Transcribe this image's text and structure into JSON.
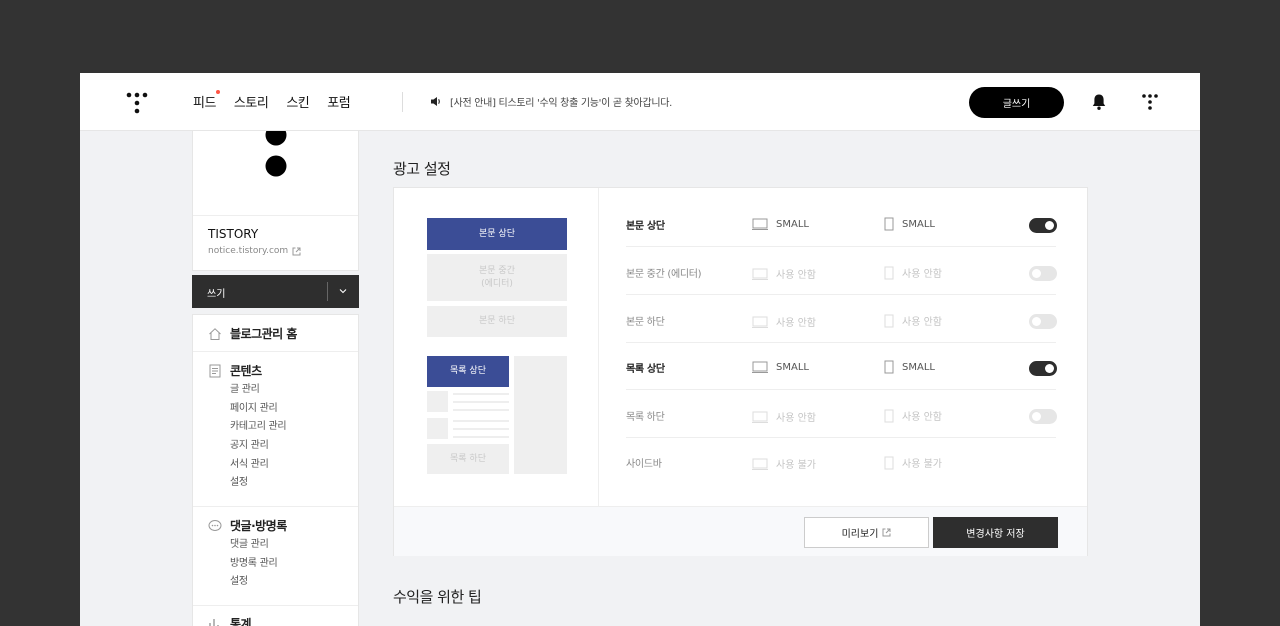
{
  "header": {
    "nav": [
      "피드",
      "스토리",
      "스킨",
      "포럼"
    ],
    "notice": "[사전 안내] 티스토리 '수익 창출 기능'이 곧 찾아갑니다.",
    "write_button": "글쓰기",
    "accent_color": "#ff5544"
  },
  "sidebar": {
    "blog_name": "TISTORY",
    "blog_url": "notice.tistory.com",
    "write_label": "쓰기",
    "home_label": "블로그관리 홈",
    "groups": [
      {
        "title": "콘텐츠",
        "icon": "document-icon",
        "items": [
          "글 관리",
          "페이지 관리",
          "카테고리 관리",
          "공지 관리",
          "서식 관리",
          "설정"
        ]
      },
      {
        "title": "댓글·방명록",
        "icon": "comment-icon",
        "items": [
          "댓글 관리",
          "방명록 관리",
          "설정"
        ]
      },
      {
        "title": "통계",
        "icon": "chart-icon",
        "items": []
      }
    ]
  },
  "main": {
    "ad_title": "광고 설정",
    "tips_title": "수익을 위한 팁",
    "preview": {
      "body_top": "본문 상단",
      "body_middle_line1": "본문 중간",
      "body_middle_line2": "(에디터)",
      "body_bottom": "본문 하단",
      "list_top": "목록 상단",
      "list_bottom": "목록 하단",
      "active_color": "#3b4d96"
    },
    "rows": [
      {
        "name": "본문 상단",
        "pc": "SMALL",
        "mobile": "SMALL",
        "toggle": "on"
      },
      {
        "name": "본문 중간 (에디터)",
        "pc": "사용 안함",
        "mobile": "사용 안함",
        "toggle": "off"
      },
      {
        "name": "본문 하단",
        "pc": "사용 안함",
        "mobile": "사용 안함",
        "toggle": "off"
      },
      {
        "name": "목록 상단",
        "pc": "SMALL",
        "mobile": "SMALL",
        "toggle": "on"
      },
      {
        "name": "목록 하단",
        "pc": "사용 안함",
        "mobile": "사용 안함",
        "toggle": "off"
      },
      {
        "name": "사이드바",
        "pc": "사용 불가",
        "mobile": "사용 불가",
        "toggle": "none"
      }
    ],
    "preview_button": "미리보기",
    "save_button": "변경사항 저장"
  }
}
